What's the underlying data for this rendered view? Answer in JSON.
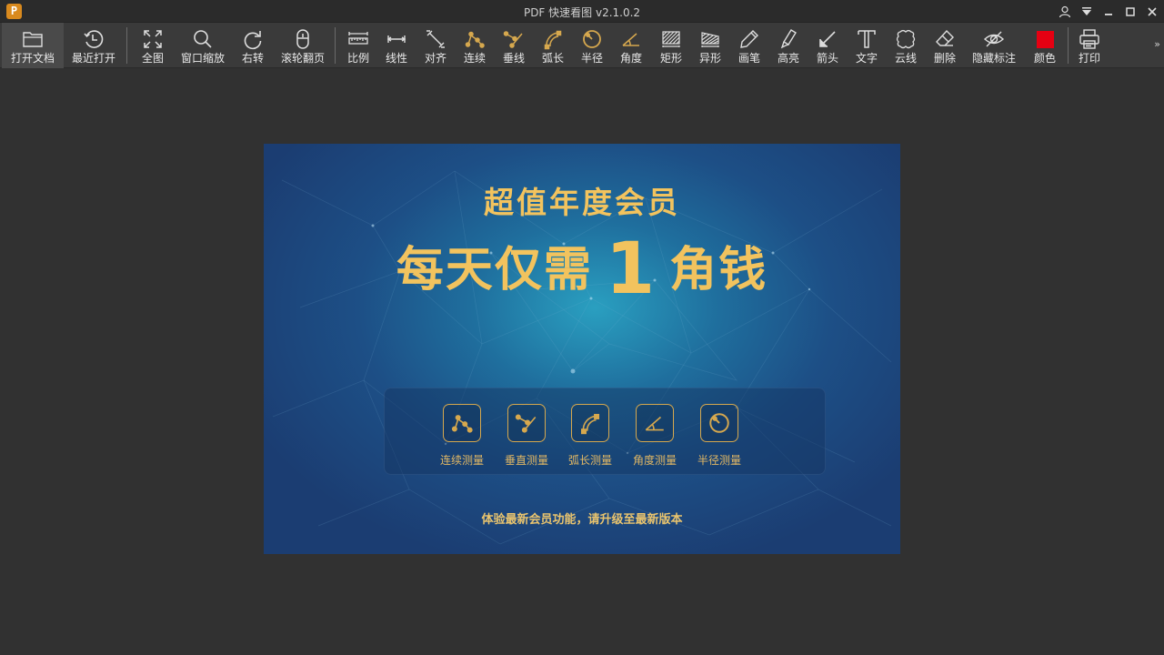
{
  "app": {
    "logo_letter": "P",
    "title": "PDF 快速看图 v2.1.0.2"
  },
  "window_controls": [
    "user-icon",
    "dropdown-icon",
    "minimize-icon",
    "maximize-icon",
    "close-icon"
  ],
  "toolbar": {
    "items": [
      {
        "id": "open",
        "label": "打开文档",
        "icon": "folder-icon",
        "active": true
      },
      {
        "id": "recent",
        "label": "最近打开",
        "icon": "history-icon"
      },
      {
        "id": "fit",
        "label": "全图",
        "icon": "fullscreen-icon"
      },
      {
        "id": "zoom",
        "label": "窗口缩放",
        "icon": "zoom-icon"
      },
      {
        "id": "rotate",
        "label": "右转",
        "icon": "rotate-right-icon"
      },
      {
        "id": "wheel",
        "label": "滚轮翻页",
        "icon": "mouse-icon"
      },
      {
        "id": "scale",
        "label": "比例",
        "icon": "ruler-icon"
      },
      {
        "id": "linear",
        "label": "线性",
        "icon": "linear-measure-icon"
      },
      {
        "id": "align",
        "label": "对齐",
        "icon": "aligned-measure-icon"
      },
      {
        "id": "continuous",
        "label": "连续",
        "icon": "polyline-icon"
      },
      {
        "id": "perpendicular",
        "label": "垂线",
        "icon": "perpendicular-icon"
      },
      {
        "id": "arc",
        "label": "弧长",
        "icon": "arc-icon"
      },
      {
        "id": "radius",
        "label": "半径",
        "icon": "radius-icon"
      },
      {
        "id": "angle",
        "label": "角度",
        "icon": "angle-icon"
      },
      {
        "id": "rect",
        "label": "矩形",
        "icon": "rectangle-area-icon"
      },
      {
        "id": "irregular",
        "label": "异形",
        "icon": "irregular-area-icon"
      },
      {
        "id": "pen",
        "label": "画笔",
        "icon": "pen-icon"
      },
      {
        "id": "highlight",
        "label": "高亮",
        "icon": "highlighter-icon"
      },
      {
        "id": "arrow",
        "label": "箭头",
        "icon": "arrow-icon"
      },
      {
        "id": "text",
        "label": "文字",
        "icon": "text-icon"
      },
      {
        "id": "cloud",
        "label": "云线",
        "icon": "cloud-icon"
      },
      {
        "id": "delete",
        "label": "删除",
        "icon": "eraser-icon"
      },
      {
        "id": "hide",
        "label": "隐藏标注",
        "icon": "eye-off-icon"
      },
      {
        "id": "color",
        "label": "颜色",
        "icon": "color-swatch-icon"
      },
      {
        "id": "print",
        "label": "打印",
        "icon": "printer-icon"
      }
    ],
    "more": "»"
  },
  "promo": {
    "headline": "超值年度会员",
    "price_prefix": "每天仅需",
    "price_number": "1",
    "price_suffix": "角钱",
    "features": [
      {
        "label": "连续测量",
        "icon": "polyline-icon"
      },
      {
        "label": "垂直测量",
        "icon": "perpendicular-icon"
      },
      {
        "label": "弧长测量",
        "icon": "arc-icon"
      },
      {
        "label": "角度测量",
        "icon": "angle-icon"
      },
      {
        "label": "半径测量",
        "icon": "radius-icon"
      }
    ],
    "footer": "体验最新会员功能，请升级至最新版本"
  },
  "colors": {
    "accent_gold": "#f2c35e",
    "selected_color": "#e60012",
    "toolbar_bg": "#3a3a3a",
    "canvas_bg": "#313131"
  }
}
